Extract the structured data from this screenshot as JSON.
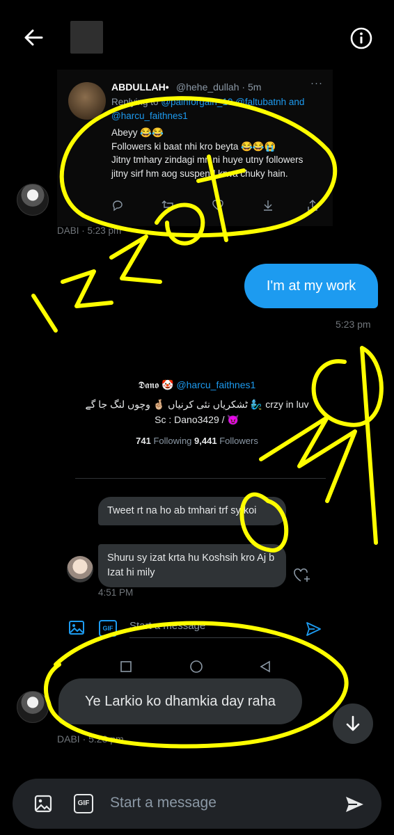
{
  "header": {
    "back_icon": "arrow-left-icon",
    "info_icon": "info-circle-icon"
  },
  "tweet": {
    "name": "ABDULLAH•",
    "handle": "@hehe_dullah · 5m",
    "replying_prefix": "Replying to",
    "mention1": "@painforgain_10",
    "mention2": "@faltubatnh",
    "and_text": "and",
    "mention3": "@harcu_faithnes1",
    "body": "Abeyy 😂😂\nFollowers ki baat nhi kro beyta 😂😂😭\nJitny tmhary zindagi mn ni huye utny followers jitny sirf hm aog suspend krwa chuky hain.",
    "more": "···"
  },
  "message1": {
    "meta": "DABI · 5:23 pm"
  },
  "message2": {
    "text": "I'm at my work",
    "time": "5:23 pm"
  },
  "profile": {
    "name": "𝕯𝖆𝖓𝖔 🤡",
    "handle": "@harcu_faithnes1",
    "bio1": "ٹشکریاں نئی کرنیاں 🤞🏼 وچوں لنگ جا گے 🧞‍♂️ crzy in luv",
    "bio2": "Sc : Dano3429 / 😈",
    "following_count": "741",
    "following_label": "Following",
    "followers_count": "9,441",
    "followers_label": "Followers"
  },
  "inner_messages": [
    {
      "text": "Tweet rt na ho ab tmhari trf sy koi"
    },
    {
      "text": "Shuru sy izat krta hu Koshsih kro Aj b Izat hi mily"
    }
  ],
  "inner_time": "4:51 PM",
  "inner_composer": {
    "placeholder": "Start a message",
    "gif": "GIF"
  },
  "message3": {
    "text": "Ye Larkio ko dhamkia day raha",
    "meta": "DABI · 5:23 pm"
  },
  "composer": {
    "placeholder": "Start a message",
    "gif": "GIF"
  },
  "annotations": [
    "IZZAT",
    "OMG"
  ],
  "colors": {
    "accent": "#1d9bf0",
    "ink": "#ffff00",
    "bubble_in": "#2f3336",
    "background": "#000000"
  }
}
